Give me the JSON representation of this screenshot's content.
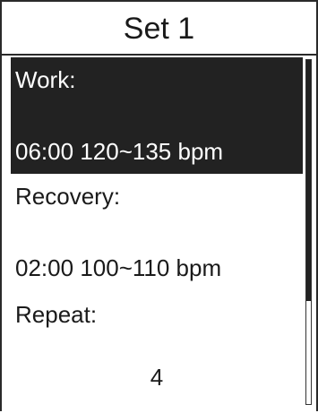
{
  "screen": {
    "title": "Set 1"
  },
  "items": [
    {
      "label": "Work:",
      "time": "06:00",
      "range": "120~135 bpm",
      "selected": true
    },
    {
      "label": "Recovery:",
      "time": "02:00",
      "range": "100~110 bpm",
      "selected": false
    },
    {
      "label": "Repeat:",
      "value": "4",
      "selected": false
    }
  ],
  "scroll": {
    "visible_fraction": 0.7
  },
  "colors": {
    "selected_background": "#222222",
    "selected_text": "#ffffff",
    "text": "#1a1a1a"
  }
}
